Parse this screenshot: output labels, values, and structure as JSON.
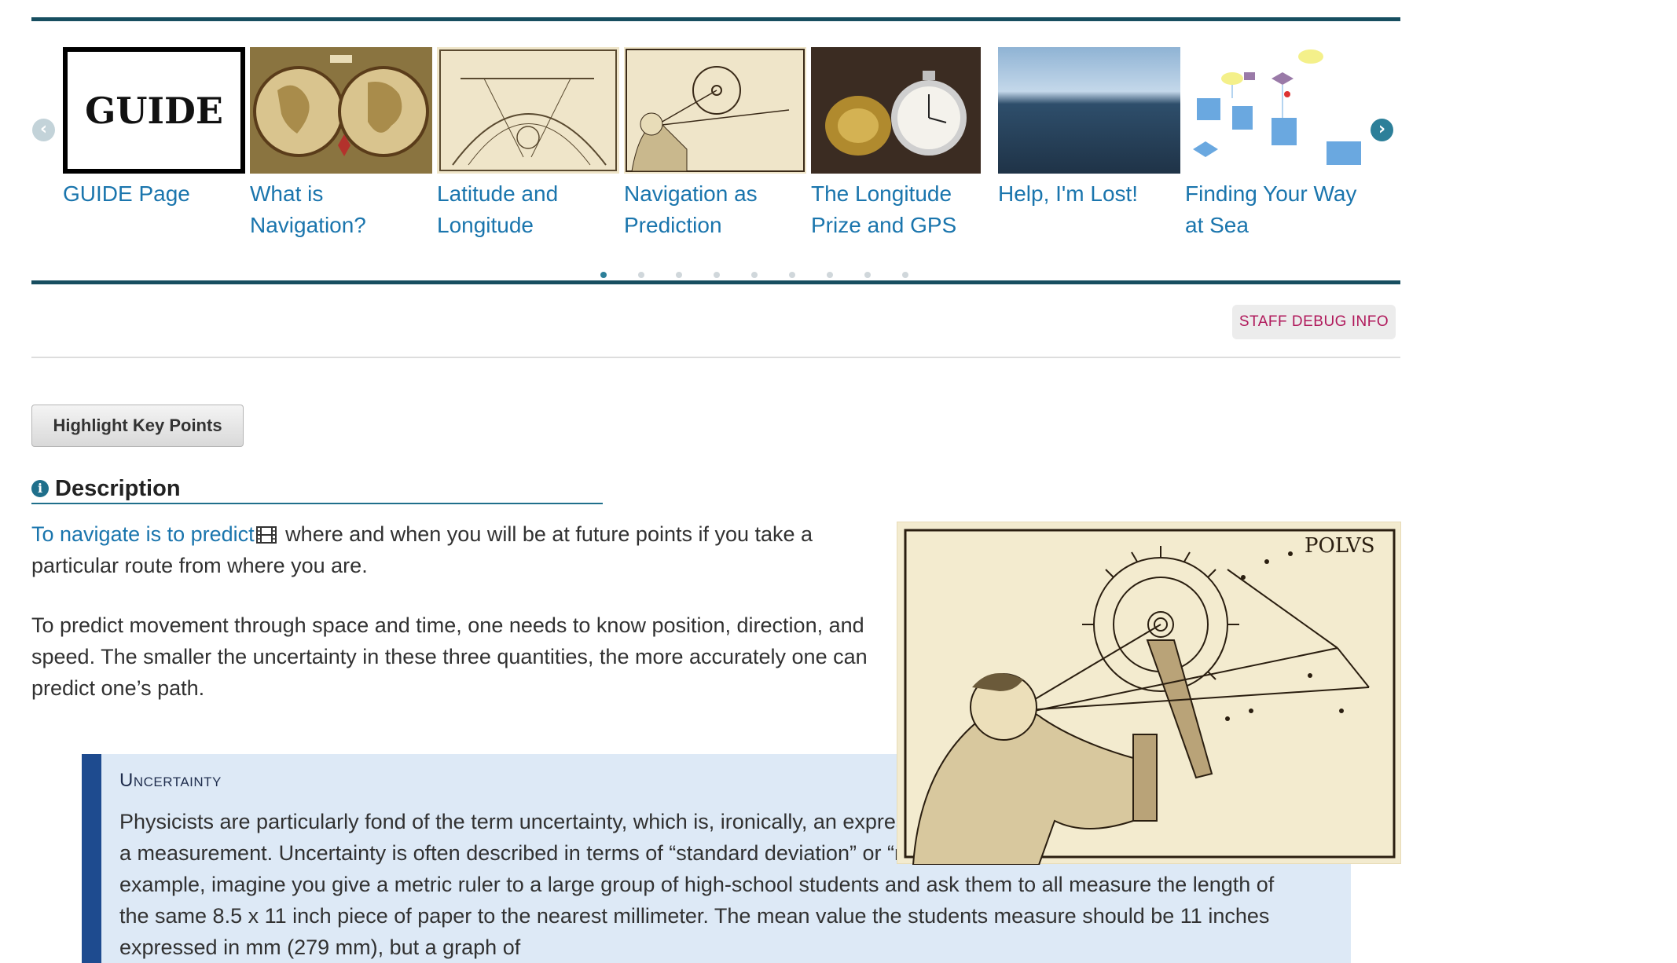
{
  "carousel": {
    "prev_label": "‹",
    "next_label": "›",
    "slides": [
      {
        "caption": "GUIDE Page",
        "thumb_text": "GUIDE"
      },
      {
        "caption": "What is Navigation?"
      },
      {
        "caption": "Latitude and Longitude"
      },
      {
        "caption": "Navigation as Prediction"
      },
      {
        "caption": "The Longitude Prize and GPS"
      },
      {
        "caption": "Help, I'm Lost!"
      },
      {
        "caption": "Finding Your Way at Sea"
      }
    ],
    "dot_count": 9,
    "active_dot": 0
  },
  "debug": {
    "label": "STAFF DEBUG INFO"
  },
  "highlight_button": {
    "label": "Highlight Key Points"
  },
  "description": {
    "heading": "Description",
    "para1_link": "To navigate is to predict",
    "para1_rest": " where and when you will be at future points if you take a particular route from where you are.",
    "para2": "To predict movement through space and time, one needs to know position, direction, and speed. The smaller the uncertainty in these three quantities, the more accurately one can predict one’s path."
  },
  "etching": {
    "label": "POLVS"
  },
  "callout": {
    "title": "Uncertainty",
    "text": "Physicists are particularly fond of the term uncertainty, which is, ironically, an expression of a degree of “certainty” ascribed to a measurement. Uncertainty is often described in terms of “standard deviation” or “margin of error.” To take a real-world example, imagine you give a metric ruler to a large group of high-school students and ask them to all measure the length of the same 8.5 x 11 inch piece of paper to the nearest millimeter. The mean value the students measure should be 11 inches expressed in mm (279 mm), but a graph of"
  },
  "colors": {
    "accent": "#174e60",
    "link": "#1a75ad",
    "debug_text": "#b0195b",
    "callout_bg": "#dde9f6",
    "callout_bar": "#1e4b8f"
  }
}
